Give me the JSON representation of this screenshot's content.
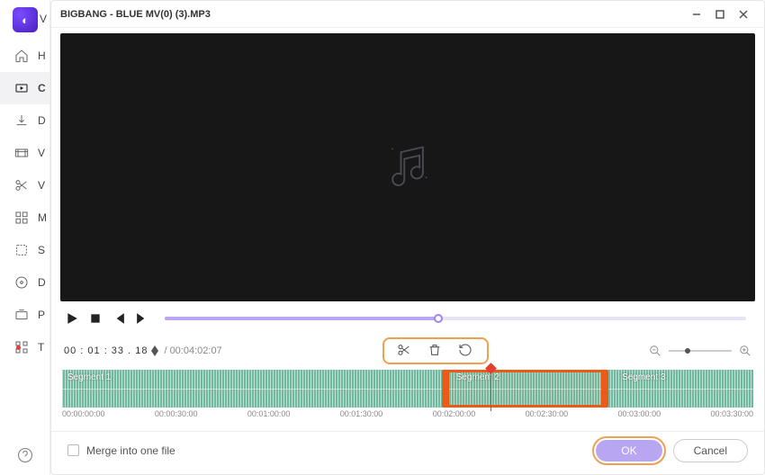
{
  "titlebar": {
    "title": "BIGBANG - BLUE MV(0) (3).MP3"
  },
  "sidebar": {
    "items": [
      {
        "letter": "V"
      },
      {
        "letter": "H"
      },
      {
        "letter": "C"
      },
      {
        "letter": "D"
      },
      {
        "letter": "V"
      },
      {
        "letter": "V"
      },
      {
        "letter": "M"
      },
      {
        "letter": "S"
      },
      {
        "letter": "D"
      },
      {
        "letter": "P"
      },
      {
        "letter": "T"
      }
    ]
  },
  "time": {
    "current": "00 : 01 : 33 . 18",
    "total": "/ 00:04:02:07"
  },
  "segments": {
    "s1": "Segment 1",
    "s2": "Segment 2",
    "s3": "Segment 3"
  },
  "ruler": [
    "00:00:00:00",
    "00:00:30:00",
    "00:01:00:00",
    "00:01:30:00",
    "00:02:00:00",
    "00:02:30:00",
    "00:03:00:00",
    "00:03:30:00"
  ],
  "footer": {
    "merge": "Merge into one file",
    "ok": "OK",
    "cancel": "Cancel"
  },
  "icons": {
    "cut": "cut-icon",
    "trash": "trash-icon",
    "rotate": "rotate-icon",
    "zoom_out": "zoom-out-icon",
    "zoom_in": "zoom-in-icon"
  }
}
